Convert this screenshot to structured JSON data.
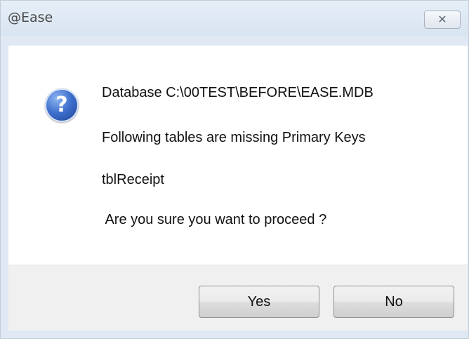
{
  "window": {
    "title": "@Ease",
    "close_glyph": "✕"
  },
  "message": {
    "icon": "question-icon",
    "icon_glyph": "?",
    "line1": "Database C:\\00TEST\\BEFORE\\EASE.MDB",
    "line2": "Following tables are missing Primary Keys",
    "line3": "tblReceipt",
    "line4": " Are you sure you want to proceed ?"
  },
  "buttons": {
    "yes_label": "Yes",
    "no_label": "No"
  },
  "colors": {
    "title_bar": "#dfe8f3",
    "footer": "#f0f0f0",
    "icon_blue": "#3d6fcc"
  }
}
